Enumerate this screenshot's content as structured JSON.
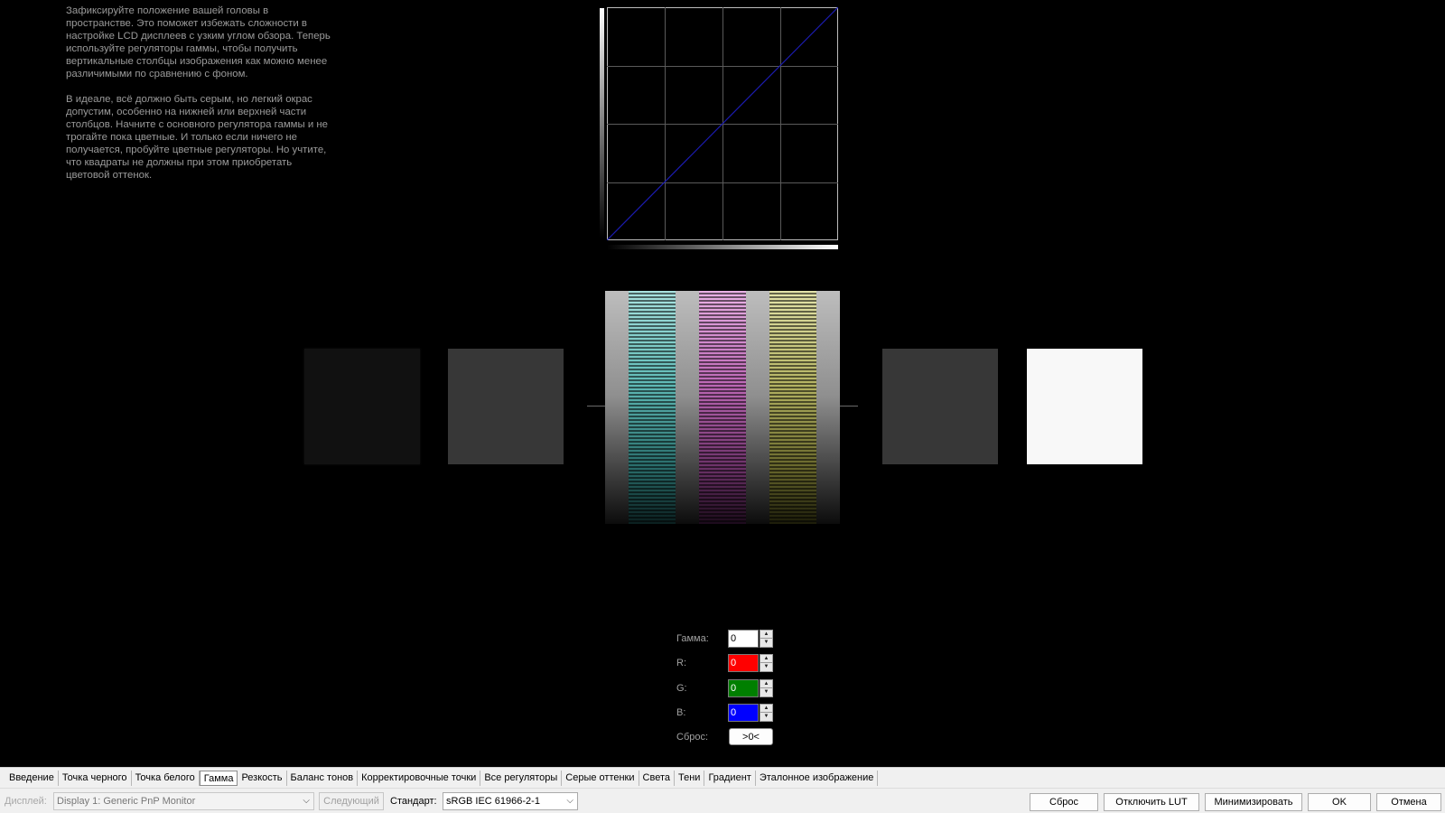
{
  "instructions": {
    "paragraph1": "Зафиксируйте положение вашей головы в пространстве. Это поможет избежать сложности в настройке LCD дисплеев с узким углом обзора. Теперь используйте регуляторы гаммы, чтобы получить вертикальные столбцы изображения как можно менее различимыми по сравнению с фоном.",
    "paragraph2": "В идеале, всё должно быть серым, но легкий окрас допустим, особенно на нижней или верхней части столбцов. Начните с основного регулятора гаммы и не трогайте пока цветные. И только если ничего не получается, пробуйте цветные регуляторы. Но учтите, что квадраты не должны при этом приобретать цветовой оттенок."
  },
  "curve": {
    "grid_divisions": 4,
    "line_color": "#1b1bb0",
    "grid_color": "#5a5a5a"
  },
  "controls": {
    "gamma_label": "Гамма:",
    "gamma_value": "0",
    "r_label": "R:",
    "r_value": "0",
    "g_label": "G:",
    "g_value": "0",
    "b_label": "B:",
    "b_value": "0",
    "reset_label": "Сброс:",
    "reset_button": ">0<",
    "spin_up_icon": "▲",
    "spin_down_icon": "▼"
  },
  "tabs": [
    "Введение",
    "Точка черного",
    "Точка белого",
    "Гамма",
    "Резкость",
    "Баланс тонов",
    "Корректировочные точки",
    "Все регуляторы",
    "Серые оттенки",
    "Света",
    "Тени",
    "Градиент",
    "Эталонное изображение"
  ],
  "active_tab": "Гамма",
  "bottombar": {
    "display_label": "Дисплей:",
    "display_value": "Display 1: Generic PnP Monitor",
    "next_button": "Следующий",
    "standard_label": "Стандарт:",
    "standard_value": "sRGB IEC 61966-2-1",
    "chevron_icon": "⌵",
    "reset_button": "Сброс",
    "disable_lut_button": "Отключить LUT",
    "minimize_button": "Минимизировать",
    "ok_button": "OK",
    "cancel_button": "Отмена"
  }
}
